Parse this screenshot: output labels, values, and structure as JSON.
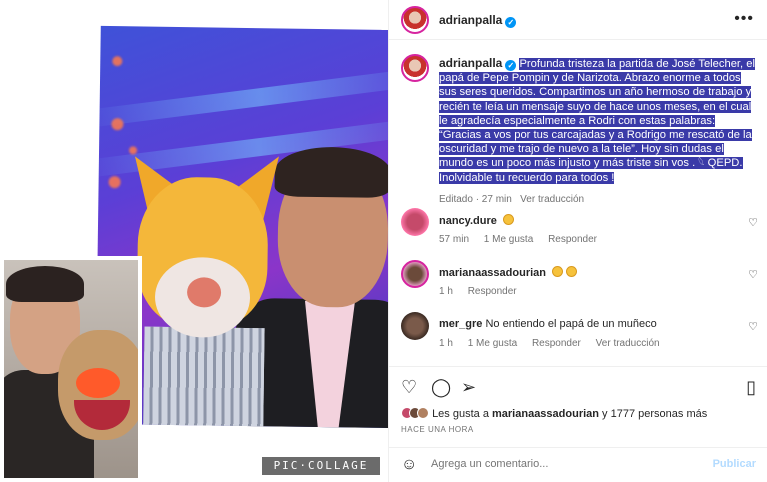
{
  "header": {
    "username": "adrianpalla",
    "more": "•••"
  },
  "caption": {
    "username": "adrianpalla",
    "text": "Profunda tristeza la partida de José Telecher, el papá de Pepe Pompin y de Narizota. Abrazo enorme a todos sus seres queridos. Compartimos un año hermoso de trabajo y recién te leía un mensaje suyo de hace unos meses, en el cual le agradecía especialmente a Rodri con estas palabras: “Gracias a vos por tus carcajadas y a Rodrigo me rescató de la oscuridad y me trajo de nuevo a la tele”. Hoy sin dudas el mundo es un poco más injusto y más triste sin vos . 𓆩 QEPD. Inolvidable tu recuerdo para todos !",
    "edited": "Editado · 27 min",
    "translate": "Ver traducción"
  },
  "comments": [
    {
      "user": "nancy.dure",
      "text": "",
      "time": "57 min",
      "likes": "1 Me gusta",
      "reply": "Responder",
      "translate": ""
    },
    {
      "user": "marianaassadourian",
      "text": "",
      "time": "1 h",
      "likes": "",
      "reply": "Responder",
      "translate": ""
    },
    {
      "user": "mer_gre",
      "text": "No entiendo el papá de un muñeco",
      "time": "1 h",
      "likes": "1 Me gusta",
      "reply": "Responder",
      "translate": "Ver traducción"
    }
  ],
  "likes": {
    "prefix": "Les gusta a ",
    "user": "marianaassadourian",
    "suffix": " y 1777 personas más"
  },
  "timestamp": "HACE UNA HORA",
  "add_comment": {
    "placeholder": "Agrega un comentario...",
    "post": "Publicar"
  },
  "watermark": "PIC·COLLAGE",
  "icons": {
    "like": "heart-icon",
    "comment": "comment-icon",
    "share": "paper-plane-icon",
    "save": "bookmark-icon",
    "emoji": "smiley-icon"
  },
  "colors": {
    "verified": "#0095f6",
    "selection": "#3a3aa8",
    "muted": "#737373",
    "post_disabled": "#b3dbff"
  }
}
